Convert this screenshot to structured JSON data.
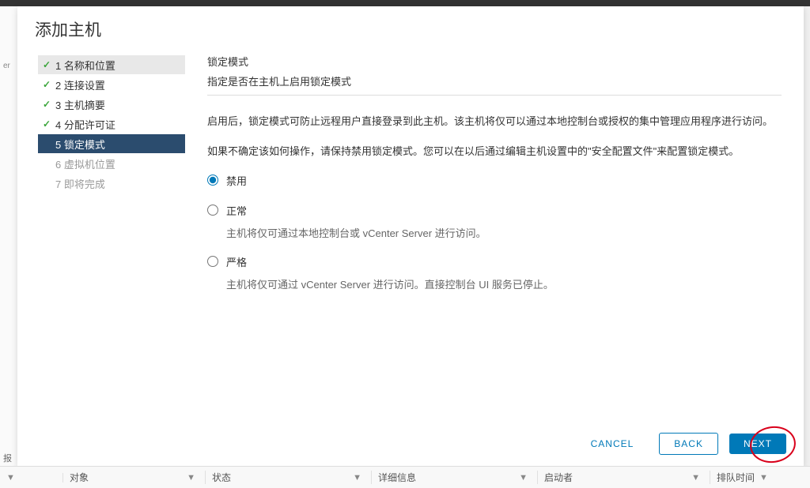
{
  "modal": {
    "title": "添加主机"
  },
  "wizard": {
    "steps": [
      {
        "num": "1",
        "label": "名称和位置",
        "state": "completed",
        "highlighted": true
      },
      {
        "num": "2",
        "label": "连接设置",
        "state": "completed"
      },
      {
        "num": "3",
        "label": "主机摘要",
        "state": "completed"
      },
      {
        "num": "4",
        "label": "分配许可证",
        "state": "completed"
      },
      {
        "num": "5",
        "label": "锁定模式",
        "state": "active"
      },
      {
        "num": "6",
        "label": "虚拟机位置",
        "state": "pending"
      },
      {
        "num": "7",
        "label": "即将完成",
        "state": "pending"
      }
    ]
  },
  "content": {
    "title": "锁定模式",
    "subtitle": "指定是否在主机上启用锁定模式",
    "description1": "启用后，锁定模式可防止远程用户直接登录到此主机。该主机将仅可以通过本地控制台或授权的集中管理应用程序进行访问。",
    "description2": "如果不确定该如何操作，请保持禁用锁定模式。您可以在以后通过编辑主机设置中的\"安全配置文件\"来配置锁定模式。"
  },
  "options": {
    "disabled": {
      "label": "禁用",
      "selected": true
    },
    "normal": {
      "label": "正常",
      "description": "主机将仅可通过本地控制台或 vCenter Server 进行访问。"
    },
    "strict": {
      "label": "严格",
      "description": "主机将仅可通过 vCenter Server 进行访问。直接控制台 UI 服务已停止。"
    }
  },
  "buttons": {
    "cancel": "CANCEL",
    "back": "BACK",
    "next": "NEXT"
  },
  "table": {
    "col_object": "对象",
    "col_status": "状态",
    "col_details": "详细信息",
    "col_initiator": "启动者",
    "col_queued": "排队时间"
  },
  "leftLabel": "报",
  "sliverText": "er"
}
